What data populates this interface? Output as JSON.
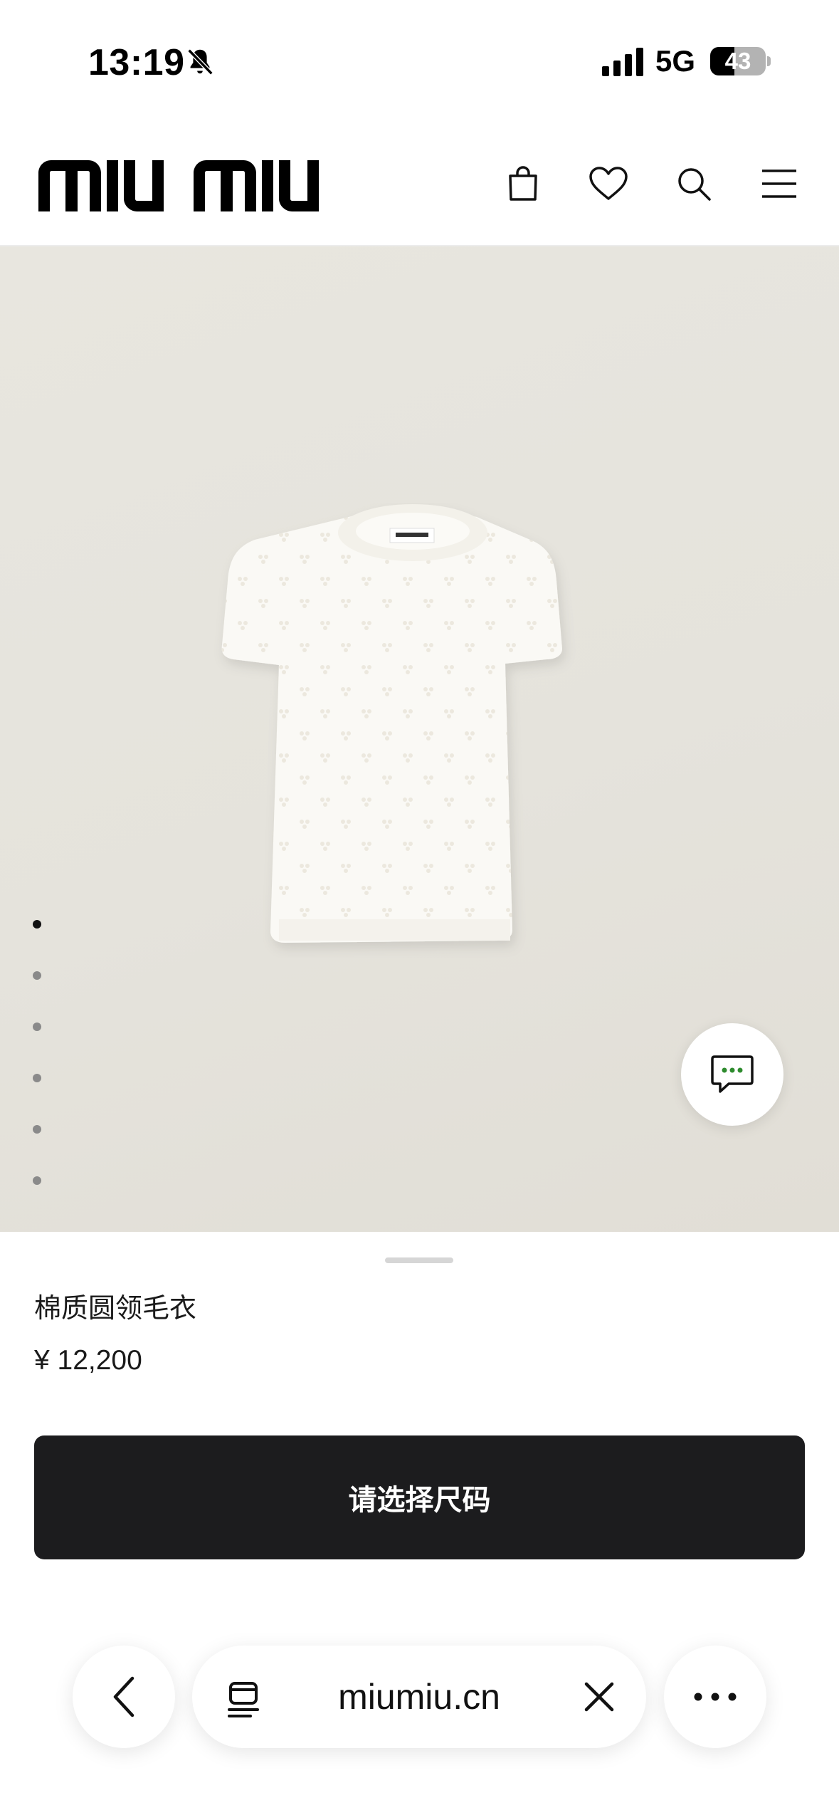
{
  "status_bar": {
    "time": "13:19",
    "mute_icon": "bell-slash-icon",
    "signal_icon": "cellular-signal-icon",
    "network": "5G",
    "battery_level": "43",
    "battery_fraction": 0.43
  },
  "header": {
    "logo_text": "miu miu",
    "icons": [
      "shopping-bag-icon",
      "heart-icon",
      "search-icon",
      "menu-icon"
    ]
  },
  "gallery": {
    "image_subject": "white cotton crew-neck knit sweater",
    "image_count": 6,
    "active_index": 0,
    "background_color": "#e6e4dd",
    "chat_icon": "chat-bubble-icon",
    "chat_dots_color": "#2e8b2e"
  },
  "product": {
    "name": "棉质圆领毛衣",
    "price": "¥ 12,200"
  },
  "cta": {
    "label": "请选择尺码",
    "background_color": "#1c1c1e"
  },
  "browser": {
    "url": "miumiu.cn",
    "back_icon": "chevron-left-icon",
    "tabs_icon": "tabs-icon",
    "close_icon": "close-icon",
    "more_icon": "more-horizontal-icon"
  }
}
